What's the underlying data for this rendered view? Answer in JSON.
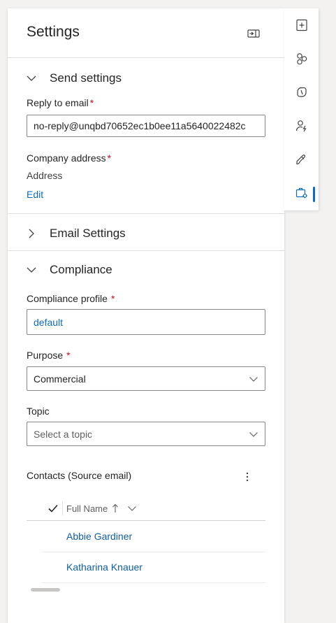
{
  "panel": {
    "title": "Settings"
  },
  "send_settings": {
    "heading": "Send settings",
    "reply_to_label": "Reply to email",
    "reply_to_value": "no-reply@unqbd70652ec1b0ee11a5640022482c",
    "company_address_label": "Company address",
    "company_address_value": "Address",
    "edit_link": "Edit"
  },
  "email_settings": {
    "heading": "Email Settings"
  },
  "compliance": {
    "heading": "Compliance",
    "profile_label": "Compliance profile",
    "profile_value": "default",
    "purpose_label": "Purpose",
    "purpose_value": "Commercial",
    "topic_label": "Topic",
    "topic_placeholder": "Select a topic"
  },
  "contacts_grid": {
    "title": "Contacts (Source email)",
    "column_header": "Full Name",
    "rows": [
      "Abbie Gardiner",
      "Katharina Knauer"
    ]
  },
  "required_marker": "*",
  "rail": {
    "icons": [
      "add-section-icon",
      "elements-icon",
      "copilot-icon",
      "personalization-icon",
      "design-paintbrush-icon",
      "settings-icon"
    ],
    "active_index": 5
  },
  "colors": {
    "accent": "#0f6cbd",
    "required": "#c50f1f",
    "link": "#115ea3"
  }
}
